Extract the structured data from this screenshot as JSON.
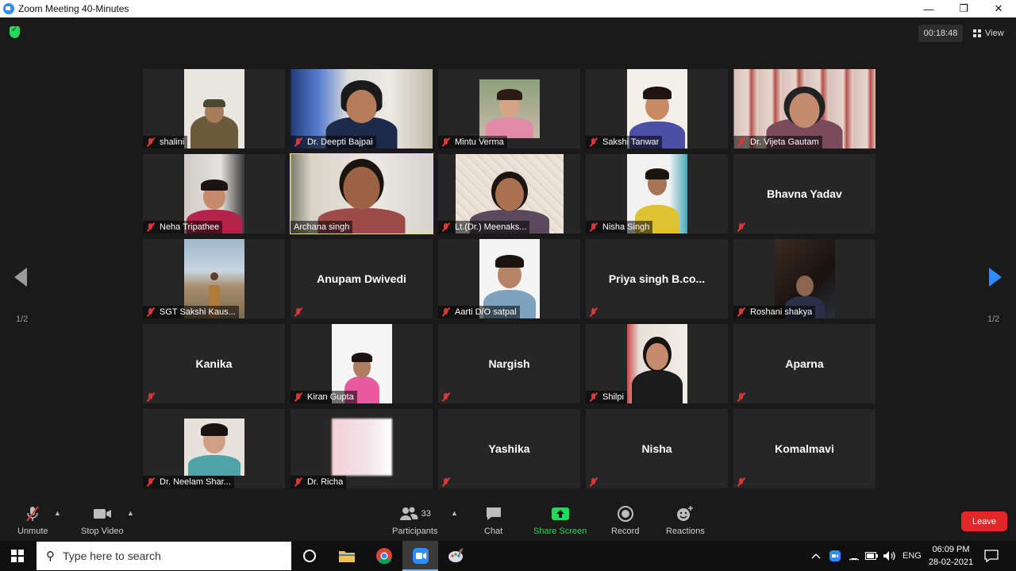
{
  "window": {
    "title": "Zoom Meeting 40-Minutes",
    "controls": {
      "minimize": "—",
      "restore": "❐",
      "close": "✕"
    }
  },
  "meeting": {
    "timer": "00:18:48",
    "view_label": "View",
    "page_left": "1/2",
    "page_right": "1/2",
    "tiles": [
      {
        "name": "shalini",
        "video": true
      },
      {
        "name": "Dr. Deepti Bajpai",
        "video": true
      },
      {
        "name": "Mintu Verma",
        "video": true
      },
      {
        "name": "Sakshi Tanwar",
        "video": true
      },
      {
        "name": "Dr. Vijeta Gautam",
        "video": true
      },
      {
        "name": "Neha Tripathee",
        "video": true
      },
      {
        "name": "Archana singh",
        "video": true,
        "active_speaker": true
      },
      {
        "name": "Lt.(Dr.) Meenaks...",
        "video": true
      },
      {
        "name": "Nisha Singh",
        "video": true
      },
      {
        "name": "Bhavna Yadav",
        "video": false
      },
      {
        "name": "SGT Sakshi Kaus...",
        "video": true
      },
      {
        "name": "Anupam Dwivedi",
        "video": false
      },
      {
        "name": "Aarti D/O satpal",
        "video": true
      },
      {
        "name": "Priya singh B.co...",
        "video": false
      },
      {
        "name": "Roshani shakya",
        "video": true
      },
      {
        "name": "Kanika",
        "video": false
      },
      {
        "name": "Kiran Gupta",
        "video": true
      },
      {
        "name": "Nargish",
        "video": false
      },
      {
        "name": "Shilpi",
        "video": true
      },
      {
        "name": "Aparna",
        "video": false
      },
      {
        "name": "Dr. Neelam Shar...",
        "video": true
      },
      {
        "name": "Dr. Richa",
        "video": true
      },
      {
        "name": "Yashika",
        "video": false
      },
      {
        "name": "Nisha",
        "video": false
      },
      {
        "name": "Komalmavi",
        "video": false
      }
    ]
  },
  "toolbar": {
    "unmute": "Unmute",
    "stop_video": "Stop Video",
    "participants": "Participants",
    "participants_count": "33",
    "chat": "Chat",
    "share_screen": "Share Screen",
    "record": "Record",
    "reactions": "Reactions",
    "leave": "Leave"
  },
  "taskbar": {
    "search_placeholder": "Type here to search",
    "language": "ENG",
    "time": "06:09 PM",
    "date": "28-02-2021"
  }
}
